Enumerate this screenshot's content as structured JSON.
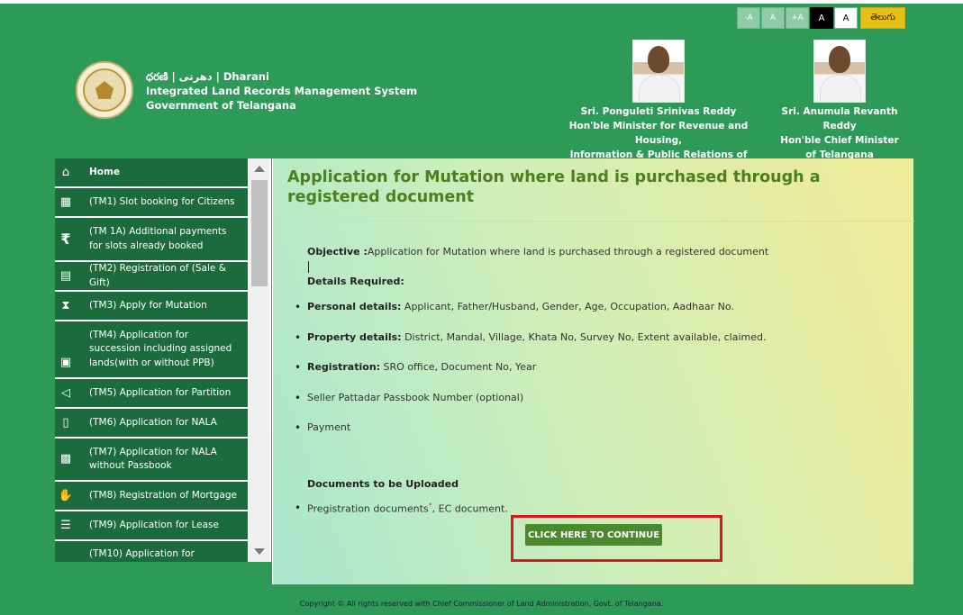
{
  "font_controls": [
    "-A",
    "A",
    "+A",
    "A",
    "A"
  ],
  "language_button": "తెలుగు",
  "header": {
    "brand_line1": "ధరణి | دھرتی | Dharani",
    "brand_line2": "Integrated Land Records Management System",
    "brand_line3": "Government of Telangana"
  },
  "ministers": [
    {
      "name": "Sri. Ponguleti Srinivas Reddy",
      "title1": "Hon'ble Minister for Revenue and Housing,",
      "title2": "Information & Public Relations of Telangana"
    },
    {
      "name": "Sri. Anumula Revanth Reddy",
      "title1": "Hon'ble Chief Minister",
      "title2": "of Telangana"
    }
  ],
  "sidebar": {
    "items": [
      {
        "label": "Home",
        "icon": "home-icon"
      },
      {
        "label": "(TM1) Slot booking for Citizens",
        "icon": "qr-icon"
      },
      {
        "label": "(TM 1A) Additional payments for slots already booked",
        "icon": "rupee-icon"
      },
      {
        "label": "(TM2) Registration of (Sale & Gift)",
        "icon": "document-icon"
      },
      {
        "label": "(TM3) Apply for Mutation",
        "icon": "hourglass-icon"
      },
      {
        "label": "(TM4) Application for succession including assigned lands(with or without PPB)",
        "icon": "file-icon"
      },
      {
        "label": "(TM5) Application for Partition",
        "icon": "partition-icon"
      },
      {
        "label": "(TM6) Application for NALA",
        "icon": "page-icon"
      },
      {
        "label": "(TM7) Application for NALA without Passbook",
        "icon": "passbook-icon"
      },
      {
        "label": "(TM8) Registration of Mortgage",
        "icon": "hand-icon"
      },
      {
        "label": "(TM9) Application for Lease",
        "icon": "list-icon"
      },
      {
        "label": "(TM10) Application for",
        "icon": "doc-icon"
      }
    ]
  },
  "main": {
    "title": "Application for Mutation where land is purchased through a registered document",
    "objective_label": "Objective :",
    "objective_text": "Application for Mutation where land is purchased through a registered document",
    "details_heading": "Details Required:",
    "details": [
      {
        "label": "Personal details:",
        "text": " Applicant, Father/Husband, Gender, Age, Occupation, Aadhaar No."
      },
      {
        "label": "Property details:",
        "text": " District, Mandal, Village, Khata No, Survey No, Extent available, claimed."
      },
      {
        "label": "Registration:",
        "text": " SRO office, Document No, Year"
      },
      {
        "label": "",
        "text": "Seller Pattadar Passbook Number (optional)"
      },
      {
        "label": "",
        "text": "Payment"
      }
    ],
    "docs_heading": "Documents to be Uploaded",
    "docs_text_a": "Pregistration documents",
    "docs_star": "*",
    "docs_text_b": ", EC document.",
    "continue_label": "CLICK HERE TO CONTINUE"
  },
  "footer": "Copyright © All rights reserved with Chief Commissioner of Land Administration, Govt. of Telangana.",
  "colors": {
    "page_bg": "#2e9a58",
    "sidebar_item": "#1c6b3d",
    "title": "#4d7f1f",
    "continue_button": "#4a8a2c",
    "highlight": "#e0161d",
    "language_button": "#e6c015"
  }
}
